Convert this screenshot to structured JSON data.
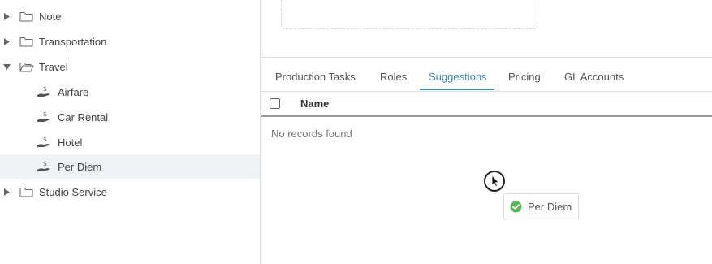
{
  "tree": {
    "items": [
      {
        "label": "Note",
        "expanded": false
      },
      {
        "label": "Transportation",
        "expanded": false
      },
      {
        "label": "Travel",
        "expanded": true,
        "children": [
          {
            "label": "Airfare"
          },
          {
            "label": "Car Rental"
          },
          {
            "label": "Hotel"
          },
          {
            "label": "Per Diem",
            "selected": true
          }
        ]
      },
      {
        "label": "Studio Service",
        "expanded": false
      }
    ]
  },
  "tabs": [
    {
      "label": "Production Tasks"
    },
    {
      "label": "Roles"
    },
    {
      "label": "Suggestions",
      "active": true
    },
    {
      "label": "Pricing"
    },
    {
      "label": "GL Accounts"
    }
  ],
  "grid": {
    "column_name": "Name",
    "empty_text": "No records found"
  },
  "drag_chip": {
    "label": "Per Diem"
  },
  "colors": {
    "accent": "#3f87b5",
    "success": "#5cb85c",
    "selected_row": "#eef2f5"
  }
}
